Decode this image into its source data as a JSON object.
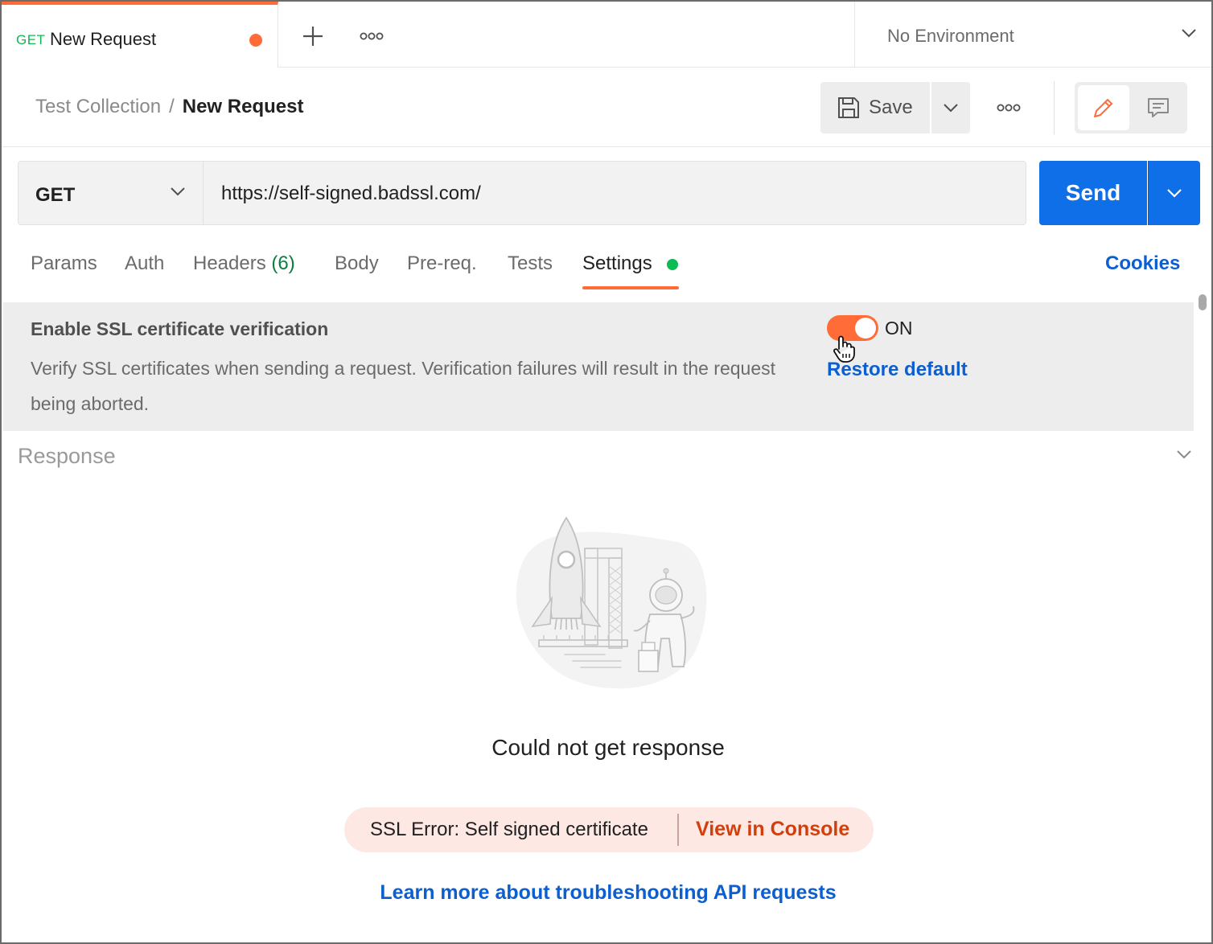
{
  "tab": {
    "method": "GET",
    "name": "New Request"
  },
  "environment": {
    "label": "No Environment"
  },
  "breadcrumb": {
    "collection": "Test Collection",
    "separator": "/",
    "request": "New Request"
  },
  "toolbar": {
    "save_label": "Save"
  },
  "request": {
    "method": "GET",
    "url": "https://self-signed.badssl.com/",
    "send_label": "Send"
  },
  "request_tabs": {
    "params": "Params",
    "auth": "Auth",
    "headers": "Headers",
    "headers_count": "(6)",
    "body": "Body",
    "prereq": "Pre-req.",
    "tests": "Tests",
    "settings": "Settings",
    "active": "Settings",
    "cookies": "Cookies"
  },
  "settings": {
    "title": "Enable SSL certificate verification",
    "description": "Verify SSL certificates when sending a request. Verification failures will result in the request being aborted.",
    "toggle_state": "ON",
    "restore_label": "Restore default"
  },
  "response": {
    "title": "Response",
    "message": "Could not get response",
    "error_text": "SSL Error: Self signed certificate",
    "console_link": "View in Console",
    "learn_more": "Learn more about troubleshooting API requests"
  },
  "colors": {
    "accent": "#ff6c37",
    "primary": "#0f6fe8",
    "link": "#0b5fd0",
    "success": "#0cbb52",
    "error": "#d23f0c",
    "error_bg": "#fde8e3"
  },
  "icons": [
    "plus-icon",
    "more-icon",
    "chevron-down-icon",
    "save-icon",
    "pencil-icon",
    "comment-icon",
    "hand-cursor-icon",
    "rocket-illustration"
  ]
}
